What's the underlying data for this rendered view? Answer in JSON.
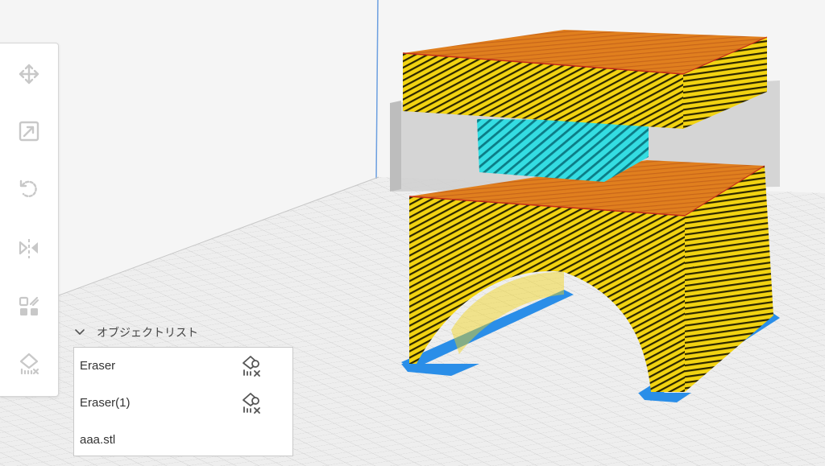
{
  "object_list": {
    "title": "オブジェクトリスト",
    "items": [
      {
        "label": "Eraser",
        "icon": "eraser-icon"
      },
      {
        "label": "Eraser(1)",
        "icon": "eraser-icon"
      },
      {
        "label": "aaa.stl",
        "icon": ""
      }
    ]
  },
  "toolbar": {
    "tools": [
      "move-icon",
      "scale-icon",
      "rotate-icon",
      "mirror-icon",
      "per-model-settings-icon",
      "support-blocker-icon"
    ]
  },
  "colors": {
    "wall_yellow": "#f2d312",
    "top_orange": "#e0801e",
    "infill_cyan": "#2fd6dc",
    "skirt_blue": "#2a8ee8",
    "icon_gray": "#c8c8c8",
    "icon_dark": "#555555"
  }
}
